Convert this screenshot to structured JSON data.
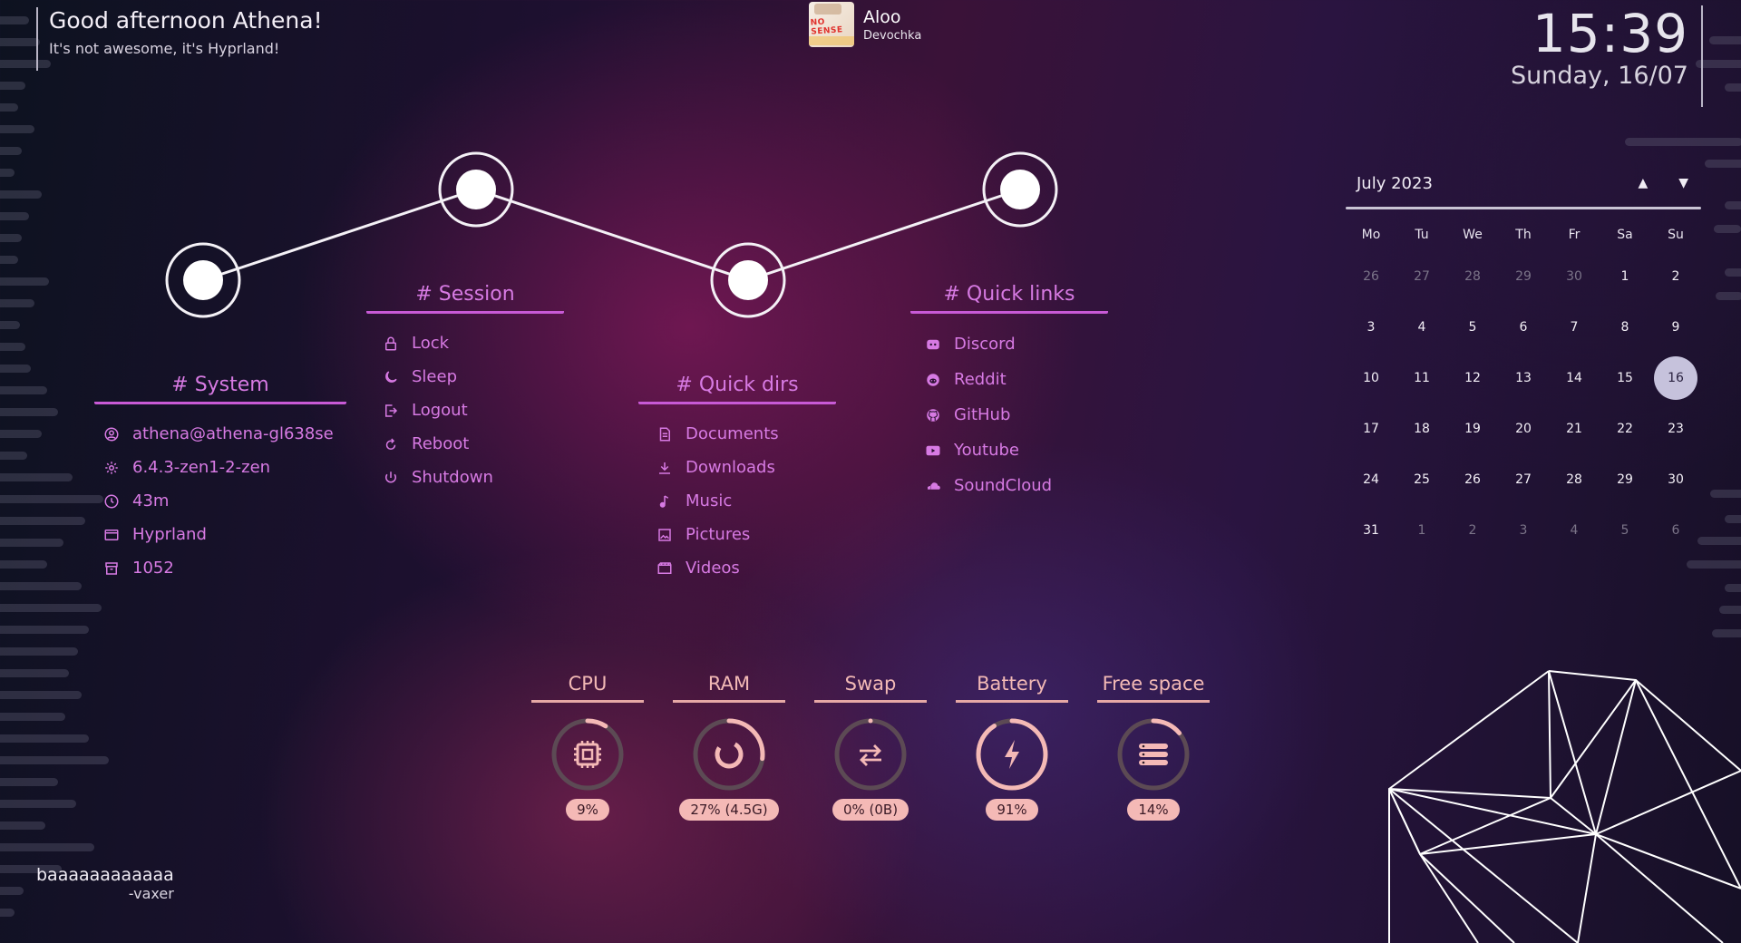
{
  "greeting": {
    "line1": "Good afternoon Athena!",
    "line2": "It's not awesome, it's Hyprland!"
  },
  "media": {
    "title": "Aloo",
    "artist": "Devochka",
    "album_art_text": "NO SENSE"
  },
  "clock": {
    "time": "15:39",
    "date": "Sunday, 16/07"
  },
  "system": {
    "title": "# System",
    "items": [
      {
        "icon": "user-circle-icon",
        "label": "athena@athena-gl638se"
      },
      {
        "icon": "kernel-gear-icon",
        "label": "6.4.3-zen1-2-zen"
      },
      {
        "icon": "clock-icon",
        "label": "43m"
      },
      {
        "icon": "window-icon",
        "label": "Hyprland"
      },
      {
        "icon": "package-icon",
        "label": "1052"
      }
    ]
  },
  "session": {
    "title": "# Session",
    "items": [
      {
        "icon": "lock-icon",
        "label": "Lock"
      },
      {
        "icon": "moon-icon",
        "label": "Sleep"
      },
      {
        "icon": "logout-icon",
        "label": "Logout"
      },
      {
        "icon": "reboot-icon",
        "label": "Reboot"
      },
      {
        "icon": "power-icon",
        "label": "Shutdown"
      }
    ]
  },
  "quick_dirs": {
    "title": "# Quick dirs",
    "items": [
      {
        "icon": "document-icon",
        "label": "Documents"
      },
      {
        "icon": "download-icon",
        "label": "Downloads"
      },
      {
        "icon": "music-note-icon",
        "label": "Music"
      },
      {
        "icon": "picture-icon",
        "label": "Pictures"
      },
      {
        "icon": "video-icon",
        "label": "Videos"
      }
    ]
  },
  "quick_links": {
    "title": "# Quick links",
    "items": [
      {
        "icon": "discord-icon",
        "label": "Discord"
      },
      {
        "icon": "reddit-icon",
        "label": "Reddit"
      },
      {
        "icon": "github-icon",
        "label": "GitHub"
      },
      {
        "icon": "youtube-icon",
        "label": "Youtube"
      },
      {
        "icon": "soundcloud-icon",
        "label": "SoundCloud"
      }
    ]
  },
  "calendar": {
    "month": "July 2023",
    "weekdays": [
      "Mo",
      "Tu",
      "We",
      "Th",
      "Fr",
      "Sa",
      "Su"
    ],
    "weeks": [
      [
        {
          "d": "26",
          "m": true
        },
        {
          "d": "27",
          "m": true
        },
        {
          "d": "28",
          "m": true
        },
        {
          "d": "29",
          "m": true
        },
        {
          "d": "30",
          "m": true
        },
        {
          "d": "1"
        },
        {
          "d": "2"
        }
      ],
      [
        {
          "d": "3"
        },
        {
          "d": "4"
        },
        {
          "d": "5"
        },
        {
          "d": "6"
        },
        {
          "d": "7"
        },
        {
          "d": "8"
        },
        {
          "d": "9"
        }
      ],
      [
        {
          "d": "10"
        },
        {
          "d": "11"
        },
        {
          "d": "12"
        },
        {
          "d": "13"
        },
        {
          "d": "14"
        },
        {
          "d": "15"
        },
        {
          "d": "16",
          "today": true
        }
      ],
      [
        {
          "d": "17"
        },
        {
          "d": "18"
        },
        {
          "d": "19"
        },
        {
          "d": "20"
        },
        {
          "d": "21"
        },
        {
          "d": "22"
        },
        {
          "d": "23"
        }
      ],
      [
        {
          "d": "24"
        },
        {
          "d": "25"
        },
        {
          "d": "26"
        },
        {
          "d": "27"
        },
        {
          "d": "28"
        },
        {
          "d": "29"
        },
        {
          "d": "30"
        }
      ],
      [
        {
          "d": "31"
        },
        {
          "d": "1",
          "m": true
        },
        {
          "d": "2",
          "m": true
        },
        {
          "d": "3",
          "m": true
        },
        {
          "d": "4",
          "m": true
        },
        {
          "d": "5",
          "m": true
        },
        {
          "d": "6",
          "m": true
        }
      ]
    ],
    "today_color": "#c6c2dc"
  },
  "resources": [
    {
      "label": "CPU",
      "value": "9%",
      "fraction": 0.09,
      "icon": "cpu-chip-icon"
    },
    {
      "label": "RAM",
      "value": "27% (4.5G)",
      "fraction": 0.27,
      "icon": "ram-ring-icon"
    },
    {
      "label": "Swap",
      "value": "0% (0B)",
      "fraction": 0.0,
      "icon": "swap-arrows-icon"
    },
    {
      "label": "Battery",
      "value": "91%",
      "fraction": 0.91,
      "icon": "lightning-icon"
    },
    {
      "label": "Free space",
      "value": "14%",
      "fraction": 0.14,
      "icon": "storage-stack-icon"
    }
  ],
  "quote": {
    "text": "baaaaaaaaaaaa",
    "author": "-vaxer"
  },
  "colors": {
    "accent": "#d77ae3",
    "gauge": "#f4b9b6",
    "track": "#5c4a54"
  }
}
